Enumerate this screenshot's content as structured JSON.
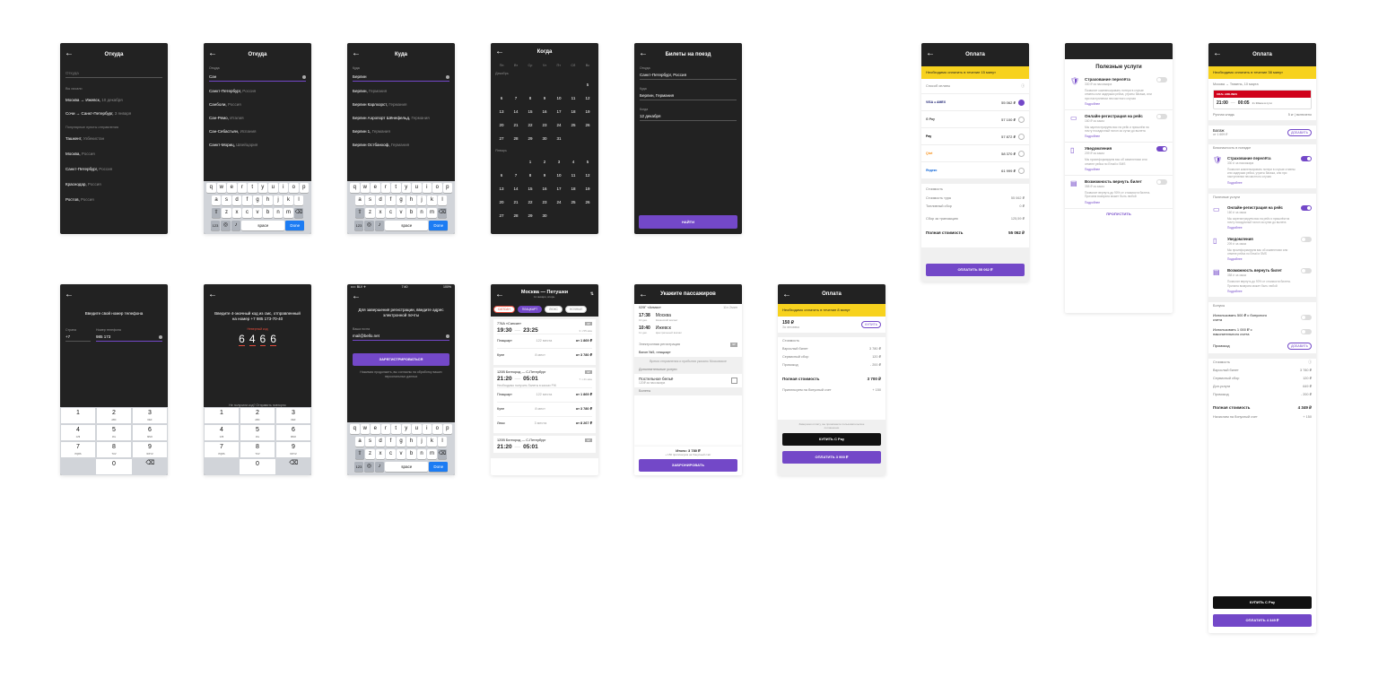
{
  "s1": {
    "title": "Откуда",
    "placeholder": "Откуда",
    "recent_title": "Вы искали",
    "recent": [
      {
        "from": "Москва",
        "to": "Ижевск",
        "date": "10 декабря"
      },
      {
        "from": "Сочи",
        "to": "Санкт-Петербург",
        "date": "3 января"
      }
    ],
    "popular_title": "Популярные пункты отправления",
    "popular": [
      {
        "city": "Ташкент",
        "country": "Узбекистан"
      },
      {
        "city": "Москва",
        "country": "Россия"
      },
      {
        "city": "Санкт-Петербург",
        "country": "Россия"
      },
      {
        "city": "Краснодар",
        "country": "Россия"
      },
      {
        "city": "Ростов",
        "country": "Россия"
      }
    ]
  },
  "s2": {
    "title": "Откуда",
    "label": "Откуда",
    "value": "Сан",
    "results": [
      {
        "city": "Санкт-Петербург",
        "country": "Россия"
      },
      {
        "city": "Санболи",
        "country": "Россия"
      },
      {
        "city": "Сан-Ремо",
        "country": "Италия"
      },
      {
        "city": "Сан-Себастьян",
        "country": "Испания"
      },
      {
        "city": "Санкт-Мориц",
        "country": "Швейцария"
      }
    ]
  },
  "s3": {
    "title": "Куда",
    "label": "Куда",
    "value": "Берлин",
    "results": [
      {
        "city": "Берлин",
        "country": "Германия"
      },
      {
        "city": "Берлин Карлхорст",
        "country": "Германия"
      },
      {
        "city": "Берлин Аэропорт Шёнефельд",
        "country": "Германия"
      },
      {
        "city": "Берлин 1",
        "country": "Германия"
      },
      {
        "city": "Берлин Остбанхоф",
        "country": "Германия"
      }
    ]
  },
  "keyboard": {
    "row1": [
      "q",
      "w",
      "e",
      "r",
      "t",
      "y",
      "u",
      "i",
      "o",
      "p"
    ],
    "row2": [
      "a",
      "s",
      "d",
      "f",
      "g",
      "h",
      "j",
      "k",
      "l"
    ],
    "row3": [
      "z",
      "x",
      "c",
      "v",
      "b",
      "n",
      "m"
    ],
    "num": "123",
    "space": "space",
    "done": "Done"
  },
  "s4": {
    "title": "Когда",
    "weekdays": [
      "Пн",
      "Вт",
      "Ср",
      "Чт",
      "Пт",
      "Сб",
      "Вс"
    ],
    "month1": "Декабрь",
    "month2": "Январь",
    "dec": [
      [
        "",
        "",
        "",
        "",
        "",
        "",
        "5"
      ],
      [
        "6",
        "7",
        "8",
        "9",
        "10",
        "11",
        "12"
      ],
      [
        "13",
        "14",
        "15",
        "16",
        "17",
        "18",
        "19"
      ],
      [
        "20",
        "21",
        "22",
        "23",
        "24",
        "25",
        "26"
      ],
      [
        "27",
        "28",
        "29",
        "30",
        "31",
        "",
        ""
      ]
    ],
    "jan": [
      [
        "",
        "",
        "1",
        "2",
        "3",
        "4",
        "5"
      ],
      [
        "6",
        "7",
        "8",
        "9",
        "10",
        "11",
        "12"
      ],
      [
        "13",
        "14",
        "15",
        "16",
        "17",
        "18",
        "19"
      ],
      [
        "20",
        "21",
        "22",
        "23",
        "24",
        "25",
        "26"
      ],
      [
        "27",
        "28",
        "29",
        "30",
        "",
        "",
        ""
      ]
    ]
  },
  "s5": {
    "title": "Билеты на поезд",
    "from_label": "Откуда",
    "from_value": "Санкт-Петербург, Россия",
    "to_label": "Куда",
    "to_value": "Берлин, Германия",
    "date_label": "Когда",
    "date_value": "12 декабря",
    "button": "НАЙТИ"
  },
  "s6": {
    "title": "Оплата",
    "warning": "Необходимо оплатить в течение 15 минут",
    "methods_title": "Способ оплаты",
    "methods": [
      {
        "name": "card",
        "price": "55 062 ₽"
      },
      {
        "name": "G Pay",
        "price": "57 100 ₽"
      },
      {
        "name": "Pay",
        "price": "57 872 ₽"
      },
      {
        "name": "Qiwi",
        "price": "58 370 ₽"
      },
      {
        "name": "Яндекс",
        "price": "61 999 ₽"
      }
    ],
    "cost_title": "Стоимость",
    "lines": [
      {
        "k": "Стоимость тура",
        "v": "55 062 ₽"
      },
      {
        "k": "Топливный сбор",
        "v": "0 ₽"
      },
      {
        "k": "Сбор за транзакцию",
        "v": "125,59 ₽"
      }
    ],
    "total_label": "Полная стоимость",
    "total": "55 062 ₽",
    "button": "ОПЛАТИТЬ 55 062 ₽"
  },
  "s7": {
    "title": "Полезные услуги",
    "items": [
      {
        "name": "Страхование перелёта",
        "price": "330 ₽ за пассажира",
        "desc": "Позволит компенсировать потери в случае отмены или задержки рейса, утраты багажа, или при наступлении несчастного случая",
        "more": "Подробнее",
        "on": false
      },
      {
        "name": "Онлайн-регистрация на рейс",
        "price": "160 ₽ за заказ",
        "desc": "Мы зарегистрируем вас на рейс и пришлём на почту посадочный талон за сутки до вылета",
        "more": "Подробнее",
        "on": false
      },
      {
        "name": "Уведомления",
        "price": "209 ₽ за заказ",
        "desc": "Мы проинформируем вас об изменениях или отмене рейса по Email и SMS",
        "more": "Подробнее",
        "on": true
      },
      {
        "name": "Возможность вернуть билет",
        "price": "358 ₽ за заказ",
        "desc": "Позволит вернуть до 90% от стоимости билета. Причина возврата может быть любой",
        "more": "Подробнее",
        "on": false
      }
    ],
    "skip": "ПРОПУСТИТЬ"
  },
  "s8": {
    "title": "Оплата",
    "warning": "Необходимо оплатить в течение 38 минут",
    "route": "Москва → Тюмень, 10 марта",
    "airline": "URAL AIRLINES",
    "dep": "21:00",
    "arr": "00:05",
    "dur": "2ч 30мин в пути",
    "cabin": "Ручная кладь",
    "cabin_v": "5 кг | включено",
    "baggage": "Багаж",
    "baggage_price": "от 1 609 ₽",
    "add": "ДОБАВИТЬ",
    "safety_title": "Безопасность в поездке",
    "safety": [
      {
        "name": "Страхование перелёта",
        "price": "330 ₽ за пассажира",
        "on": true
      }
    ],
    "useful_title": "Полезные услуги",
    "useful": [
      {
        "name": "Онлайн-регистрация на рейс",
        "price": "160 ₽ за заказ",
        "on": true
      },
      {
        "name": "Уведомления",
        "price": "209 ₽ за заказ",
        "on": false
      },
      {
        "name": "Возможность вернуть билет",
        "price": "358 ₽ за заказ",
        "on": false
      }
    ],
    "bonus_title": "Бонусы",
    "bonus": [
      {
        "label": "Использовать 500 ₽ с бонусного счета"
      },
      {
        "label": "Использовать 1 000 ₽ с накопительного счета"
      }
    ],
    "promo": "Промокод",
    "cost_title": "Стоимость",
    "lines": [
      {
        "k": "Взрослый билет",
        "v": "3 780 ₽"
      },
      {
        "k": "Сервисный сбор",
        "v": "120 ₽"
      },
      {
        "k": "Доп.услуги",
        "v": "649 ₽"
      },
      {
        "k": "Промокод",
        "v": "- 200 ₽"
      }
    ],
    "total_label": "Полная стоимость",
    "total": "4 349 ₽",
    "bonus_note": "Начислим на бонусный счет",
    "bonus_note_v": "+ 150",
    "apple_btn": "КУПИТЬ С  Pay",
    "pay_btn": "ОПЛАТИТЬ 4 349 ₽"
  },
  "s9": {
    "prompt": "Введите свой номер телефона",
    "country_label": "Страна",
    "country": "+7",
    "phone_label": "Номер телефона",
    "phone": "985 173",
    "keys": [
      [
        "1",
        ""
      ],
      [
        "2",
        "ABC"
      ],
      [
        "3",
        "DEF"
      ],
      [
        "4",
        "GHI"
      ],
      [
        "5",
        "JKL"
      ],
      [
        "6",
        "MNO"
      ],
      [
        "7",
        "PQRS"
      ],
      [
        "8",
        "TUV"
      ],
      [
        "9",
        "WXYZ"
      ],
      [
        "",
        ""
      ],
      [
        "0",
        ""
      ],
      [
        "⌫",
        ""
      ]
    ]
  },
  "s10": {
    "prompt": "Введите 4-значный код из смс, отправленный на номер +7 985 173-70-40",
    "error": "Неверный код",
    "code": [
      "6",
      "4",
      "6",
      "6"
    ],
    "resend": "Не получили код? Отправить повторно"
  },
  "s11": {
    "status_time": "7:40",
    "status_bat": "100%",
    "prompt": "Для завершения регистрации, введите адрес электронной почты",
    "email_label": "Ваша почта",
    "email": "mail@bello.net",
    "button": "ЗАРЕГИСТРИРОВАТЬСЯ",
    "note": "Нажимая продолжить, вы согласны на обработку ваших персональных данных"
  },
  "s12": {
    "title": "Москва — Петушки",
    "sub": "11 января, вторн.",
    "filters": [
      "САПСАН",
      "ПЛАЦКАРТ",
      "ЛЮКС",
      "НОЧНЫЕ"
    ],
    "trains": [
      {
        "name": "776А «Сапсан»",
        "dep": "19:30",
        "arr": "23:25",
        "dur": "3 ч 55 мин",
        "classes": [
          {
            "c": "Плацкарт",
            "s": "122 места",
            "p": "от 1 869 ₽"
          },
          {
            "c": "Купе",
            "s": "8 мест",
            "p": "от 3 780 ₽"
          }
        ]
      },
      {
        "name": "120В Белгород — С-Петербург",
        "dep": "21:20",
        "arr": "05:01",
        "dur": "7 ч 41 мин",
        "note": "Необходимо получить билеты в кассах РЖ",
        "classes": [
          {
            "c": "Плацкарт",
            "s": "122 места",
            "p": "от 1 869 ₽"
          },
          {
            "c": "Купе",
            "s": "8 мест",
            "p": "от 3 780 ₽"
          },
          {
            "c": "Люкс",
            "s": "3 места",
            "p": "от 8 267 ₽"
          }
        ]
      },
      {
        "name": "120В Белгород — С-Петербург",
        "dep": "21:20",
        "arr": "05:01",
        "dur": "",
        "classes": []
      }
    ]
  },
  "s13": {
    "title": "Укажите пассажиров",
    "train": "029Г «Алмаз»",
    "time_total": "11ч 2мин",
    "dep": "17:38",
    "dep_date": "10 дек.",
    "dep_city": "Москва",
    "dep_station": "Казанский вокзал",
    "arr": "10:40",
    "arr_date": "11 дек.",
    "arr_city": "Ижевск",
    "arr_station": "Центральный вокзал",
    "ereg": "Электронная регистрация",
    "car": "Вагон №5, плацкарт",
    "tz_note": "Время отправления и прибытия указано Московское",
    "extra_title": "Дополнительные услуги",
    "bedding": "Постельное бельё",
    "bedding_price": "120₽ за пассажира",
    "tickets_title": "Билеты",
    "total": "Итого: 3 780 ₽",
    "bonus": "+ 150 приплюсуем на бонусный счёт",
    "button": "ЗАБРОНИРОВАТЬ"
  },
  "s14": {
    "title": "Оплата",
    "warning": "Необходимо оплатить в течение 8 минут",
    "price": "150 ₽",
    "per": "За человека",
    "buy": "КУПИТЬ",
    "cost_title": "Стоимость",
    "lines": [
      {
        "k": "Взрослый билет",
        "v": "3 780 ₽"
      },
      {
        "k": "Сервисный сбор",
        "v": "120 ₽"
      },
      {
        "k": "Промокод",
        "v": "- 200 ₽"
      }
    ],
    "total_label": "Полная стоимость",
    "total": "3 700 ₽",
    "bonus_note": "Приплюсуем на бонусный счет",
    "bonus_note_v": "+ 150",
    "agreement": "Завершая оплату, вы принимаете пользовательское соглашение",
    "apple_btn": "КУПИТЬ С  Pay",
    "pay_btn": "ОПЛАТИТЬ 3 900 ₽"
  }
}
